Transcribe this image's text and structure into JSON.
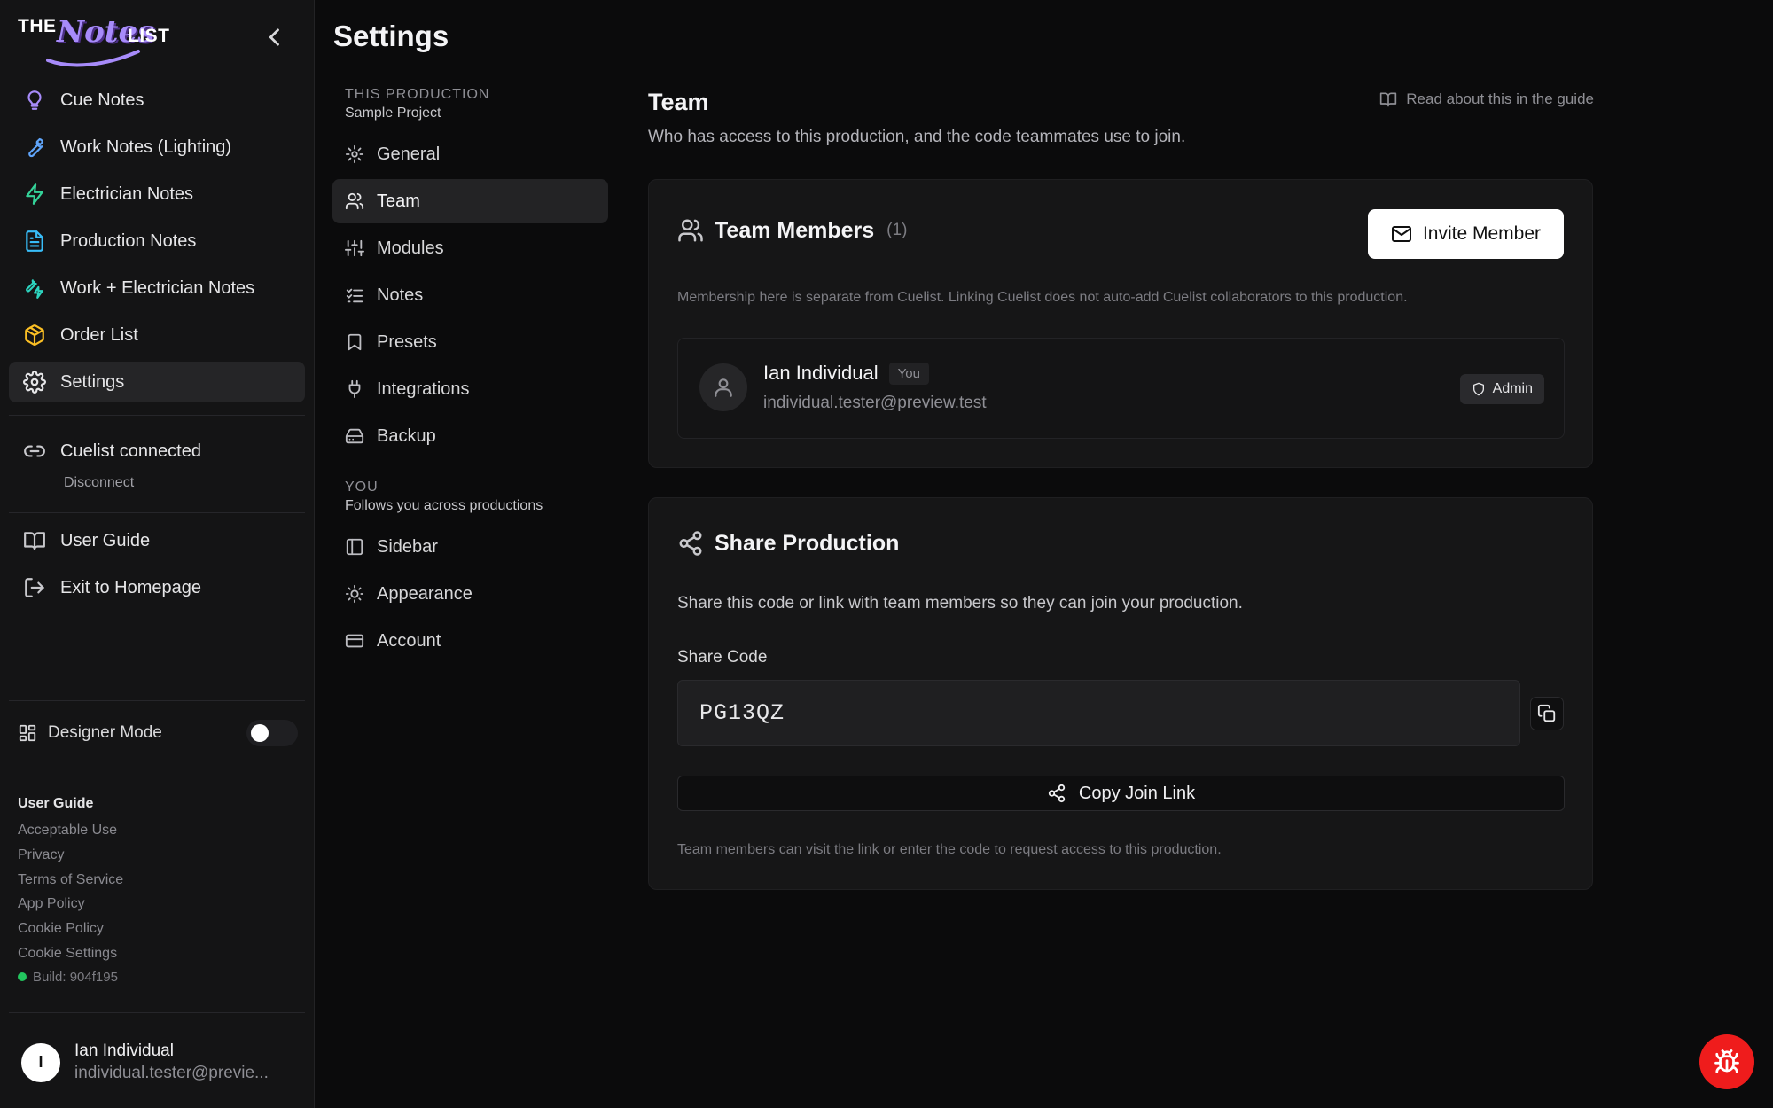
{
  "brand": {
    "the": "THE",
    "notes": "Notes",
    "list": "LIST"
  },
  "sidebar": {
    "items": [
      {
        "label": "Cue Notes",
        "icon": "lightbulb-icon",
        "color": "#a78bfa"
      },
      {
        "label": "Work Notes (Lighting)",
        "icon": "wrench-icon",
        "color": "#60a5fa"
      },
      {
        "label": "Electrician Notes",
        "icon": "zap-icon",
        "color": "#34d399"
      },
      {
        "label": "Production Notes",
        "icon": "file-text-icon",
        "color": "#38bdf8"
      },
      {
        "label": "Work + Electrician Notes",
        "icon": "wrench-zap-icon",
        "color": "#2dd4bf"
      },
      {
        "label": "Order List",
        "icon": "package-icon",
        "color": "#fbbf24"
      },
      {
        "label": "Settings",
        "icon": "gear-icon",
        "color": "#e6e6e8"
      }
    ],
    "cuelist": {
      "label": "Cuelist connected",
      "action": "Disconnect"
    },
    "footer_items": [
      {
        "label": "User Guide",
        "icon": "book-icon"
      },
      {
        "label": "Exit to Homepage",
        "icon": "log-out-icon"
      }
    ],
    "designer_mode": {
      "label": "Designer Mode",
      "enabled": false
    },
    "legal": {
      "heading": "User Guide",
      "links": [
        "Acceptable Use",
        "Privacy",
        "Terms of Service",
        "App Policy",
        "Cookie Policy",
        "Cookie Settings"
      ],
      "build": "Build: 904f195"
    },
    "user": {
      "initial": "I",
      "name": "Ian Individual",
      "email": "individual.tester@previe..."
    }
  },
  "settings": {
    "title": "Settings",
    "production_group": {
      "heading": "This Production",
      "subtitle": "Sample Project"
    },
    "production_items": [
      "General",
      "Team",
      "Modules",
      "Notes",
      "Presets",
      "Integrations",
      "Backup"
    ],
    "you_group": {
      "heading": "You",
      "subtitle": "Follows you across productions"
    },
    "you_items": [
      "Sidebar",
      "Appearance",
      "Account"
    ],
    "active": "Team"
  },
  "main": {
    "title": "Team",
    "description": "Who has access to this production, and the code teammates use to join.",
    "guide_link": "Read about this in the guide",
    "team_card": {
      "title": "Team Members",
      "count": "(1)",
      "invite_label": "Invite Member",
      "note": "Membership here is separate from Cuelist. Linking Cuelist does not auto-add Cuelist collaborators to this production.",
      "members": [
        {
          "name": "Ian Individual",
          "badge": "You",
          "email": "individual.tester@preview.test",
          "role": "Admin"
        }
      ]
    },
    "share_card": {
      "title": "Share Production",
      "description": "Share this code or link with team members so they can join your production.",
      "code_label": "Share Code",
      "code": "PG13QZ",
      "join_label": "Copy Join Link",
      "note": "Team members can visit the link or enter the code to request access to this production."
    }
  },
  "colors": {
    "accent": "#a78bfa",
    "bug_button": "#ef1c1c",
    "status_ok": "#22c55e"
  }
}
